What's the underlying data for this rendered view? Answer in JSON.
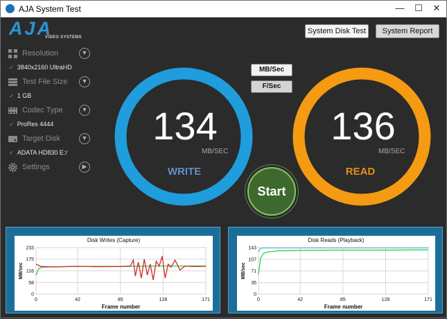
{
  "window": {
    "title": "AJA System Test",
    "minimize": "—",
    "maximize": "☐",
    "close": "✕"
  },
  "logo": {
    "text": "AJA",
    "subtitle": "VIDEO SYSTEMS"
  },
  "toolbar": {
    "disk_test": "System Disk Test",
    "report": "System Report"
  },
  "sidebar": {
    "resolution": {
      "label": "Resolution",
      "value": "3840x2160 UltraHD"
    },
    "file_size": {
      "label": "Test File Size",
      "value": "1 GB"
    },
    "codec": {
      "label": "Codec Type",
      "value": "ProRes 4444"
    },
    "disk": {
      "label": "Target Disk",
      "value": "ADATA HD830 E:/"
    },
    "settings": {
      "label": "Settings"
    }
  },
  "units": {
    "mbs": "MB/Sec",
    "fs": "F/Sec"
  },
  "write_gauge": {
    "value": "134",
    "unit": "MB/SEC",
    "label": "WRITE",
    "color": "#1f9ddc",
    "label_color": "#5f8fc7"
  },
  "read_gauge": {
    "value": "136",
    "unit": "MB/SEC",
    "label": "READ",
    "color": "#f49b13",
    "label_color": "#e09020"
  },
  "start_label": "Start",
  "chart_data": [
    {
      "type": "line",
      "title": "Disk Writes (Capture)",
      "xlabel": "Frame number",
      "ylabel": "MB/sec",
      "yticks": [
        "233",
        "175",
        "116",
        "58",
        "0"
      ],
      "xticks": [
        "0",
        "42",
        "85",
        "128",
        "171"
      ],
      "xlim": [
        0,
        171
      ],
      "ylim": [
        0,
        233
      ],
      "series": [
        {
          "color": "#2fd24a",
          "x": [
            0,
            3,
            8,
            20,
            40,
            60,
            85,
            110,
            130,
            150,
            171
          ],
          "values": [
            95,
            130,
            135,
            137,
            138,
            139,
            138,
            140,
            141,
            140,
            141
          ]
        },
        {
          "color": "#cf2a2a",
          "x": [
            0,
            5,
            20,
            40,
            60,
            85,
            95,
            98,
            100,
            103,
            106,
            109,
            112,
            115,
            118,
            121,
            124,
            127,
            130,
            133,
            136,
            140,
            145,
            150,
            160,
            171
          ],
          "values": [
            150,
            138,
            136,
            139,
            137,
            138,
            140,
            170,
            90,
            160,
            80,
            175,
            95,
            150,
            70,
            165,
            140,
            190,
            80,
            150,
            135,
            170,
            120,
            140,
            138,
            139
          ]
        }
      ]
    },
    {
      "type": "line",
      "title": "Disk Reads (Playback)",
      "xlabel": "Frame number",
      "ylabel": "MB/sec",
      "yticks": [
        "143",
        "107",
        "71",
        "35",
        "0"
      ],
      "xticks": [
        "0",
        "42",
        "85",
        "128",
        "171"
      ],
      "xlim": [
        0,
        171
      ],
      "ylim": [
        0,
        143
      ],
      "series": [
        {
          "color": "#2fd24a",
          "x": [
            0,
            2,
            5,
            10,
            20,
            40,
            80,
            120,
            171
          ],
          "values": [
            60,
            110,
            125,
            130,
            133,
            134,
            135,
            135,
            136
          ]
        },
        {
          "color": "#5fb0f0",
          "x": [
            0,
            2,
            5,
            20,
            40,
            85,
            128,
            171
          ],
          "values": [
            130,
            140,
            142,
            142,
            142,
            142,
            142,
            142
          ]
        }
      ]
    }
  ]
}
